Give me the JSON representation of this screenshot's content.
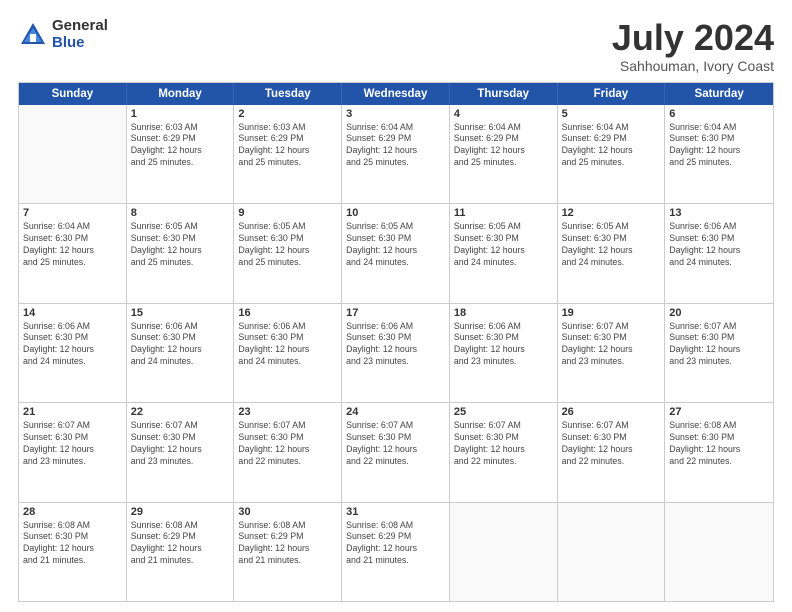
{
  "logo": {
    "general": "General",
    "blue": "Blue"
  },
  "title": "July 2024",
  "subtitle": "Sahhouman, Ivory Coast",
  "header_days": [
    "Sunday",
    "Monday",
    "Tuesday",
    "Wednesday",
    "Thursday",
    "Friday",
    "Saturday"
  ],
  "weeks": [
    [
      {
        "day": "",
        "info": ""
      },
      {
        "day": "1",
        "info": "Sunrise: 6:03 AM\nSunset: 6:29 PM\nDaylight: 12 hours\nand 25 minutes."
      },
      {
        "day": "2",
        "info": "Sunrise: 6:03 AM\nSunset: 6:29 PM\nDaylight: 12 hours\nand 25 minutes."
      },
      {
        "day": "3",
        "info": "Sunrise: 6:04 AM\nSunset: 6:29 PM\nDaylight: 12 hours\nand 25 minutes."
      },
      {
        "day": "4",
        "info": "Sunrise: 6:04 AM\nSunset: 6:29 PM\nDaylight: 12 hours\nand 25 minutes."
      },
      {
        "day": "5",
        "info": "Sunrise: 6:04 AM\nSunset: 6:29 PM\nDaylight: 12 hours\nand 25 minutes."
      },
      {
        "day": "6",
        "info": "Sunrise: 6:04 AM\nSunset: 6:30 PM\nDaylight: 12 hours\nand 25 minutes."
      }
    ],
    [
      {
        "day": "7",
        "info": "Sunrise: 6:04 AM\nSunset: 6:30 PM\nDaylight: 12 hours\nand 25 minutes."
      },
      {
        "day": "8",
        "info": "Sunrise: 6:05 AM\nSunset: 6:30 PM\nDaylight: 12 hours\nand 25 minutes."
      },
      {
        "day": "9",
        "info": "Sunrise: 6:05 AM\nSunset: 6:30 PM\nDaylight: 12 hours\nand 25 minutes."
      },
      {
        "day": "10",
        "info": "Sunrise: 6:05 AM\nSunset: 6:30 PM\nDaylight: 12 hours\nand 24 minutes."
      },
      {
        "day": "11",
        "info": "Sunrise: 6:05 AM\nSunset: 6:30 PM\nDaylight: 12 hours\nand 24 minutes."
      },
      {
        "day": "12",
        "info": "Sunrise: 6:05 AM\nSunset: 6:30 PM\nDaylight: 12 hours\nand 24 minutes."
      },
      {
        "day": "13",
        "info": "Sunrise: 6:06 AM\nSunset: 6:30 PM\nDaylight: 12 hours\nand 24 minutes."
      }
    ],
    [
      {
        "day": "14",
        "info": "Sunrise: 6:06 AM\nSunset: 6:30 PM\nDaylight: 12 hours\nand 24 minutes."
      },
      {
        "day": "15",
        "info": "Sunrise: 6:06 AM\nSunset: 6:30 PM\nDaylight: 12 hours\nand 24 minutes."
      },
      {
        "day": "16",
        "info": "Sunrise: 6:06 AM\nSunset: 6:30 PM\nDaylight: 12 hours\nand 24 minutes."
      },
      {
        "day": "17",
        "info": "Sunrise: 6:06 AM\nSunset: 6:30 PM\nDaylight: 12 hours\nand 23 minutes."
      },
      {
        "day": "18",
        "info": "Sunrise: 6:06 AM\nSunset: 6:30 PM\nDaylight: 12 hours\nand 23 minutes."
      },
      {
        "day": "19",
        "info": "Sunrise: 6:07 AM\nSunset: 6:30 PM\nDaylight: 12 hours\nand 23 minutes."
      },
      {
        "day": "20",
        "info": "Sunrise: 6:07 AM\nSunset: 6:30 PM\nDaylight: 12 hours\nand 23 minutes."
      }
    ],
    [
      {
        "day": "21",
        "info": "Sunrise: 6:07 AM\nSunset: 6:30 PM\nDaylight: 12 hours\nand 23 minutes."
      },
      {
        "day": "22",
        "info": "Sunrise: 6:07 AM\nSunset: 6:30 PM\nDaylight: 12 hours\nand 23 minutes."
      },
      {
        "day": "23",
        "info": "Sunrise: 6:07 AM\nSunset: 6:30 PM\nDaylight: 12 hours\nand 22 minutes."
      },
      {
        "day": "24",
        "info": "Sunrise: 6:07 AM\nSunset: 6:30 PM\nDaylight: 12 hours\nand 22 minutes."
      },
      {
        "day": "25",
        "info": "Sunrise: 6:07 AM\nSunset: 6:30 PM\nDaylight: 12 hours\nand 22 minutes."
      },
      {
        "day": "26",
        "info": "Sunrise: 6:07 AM\nSunset: 6:30 PM\nDaylight: 12 hours\nand 22 minutes."
      },
      {
        "day": "27",
        "info": "Sunrise: 6:08 AM\nSunset: 6:30 PM\nDaylight: 12 hours\nand 22 minutes."
      }
    ],
    [
      {
        "day": "28",
        "info": "Sunrise: 6:08 AM\nSunset: 6:30 PM\nDaylight: 12 hours\nand 21 minutes."
      },
      {
        "day": "29",
        "info": "Sunrise: 6:08 AM\nSunset: 6:29 PM\nDaylight: 12 hours\nand 21 minutes."
      },
      {
        "day": "30",
        "info": "Sunrise: 6:08 AM\nSunset: 6:29 PM\nDaylight: 12 hours\nand 21 minutes."
      },
      {
        "day": "31",
        "info": "Sunrise: 6:08 AM\nSunset: 6:29 PM\nDaylight: 12 hours\nand 21 minutes."
      },
      {
        "day": "",
        "info": ""
      },
      {
        "day": "",
        "info": ""
      },
      {
        "day": "",
        "info": ""
      }
    ]
  ]
}
